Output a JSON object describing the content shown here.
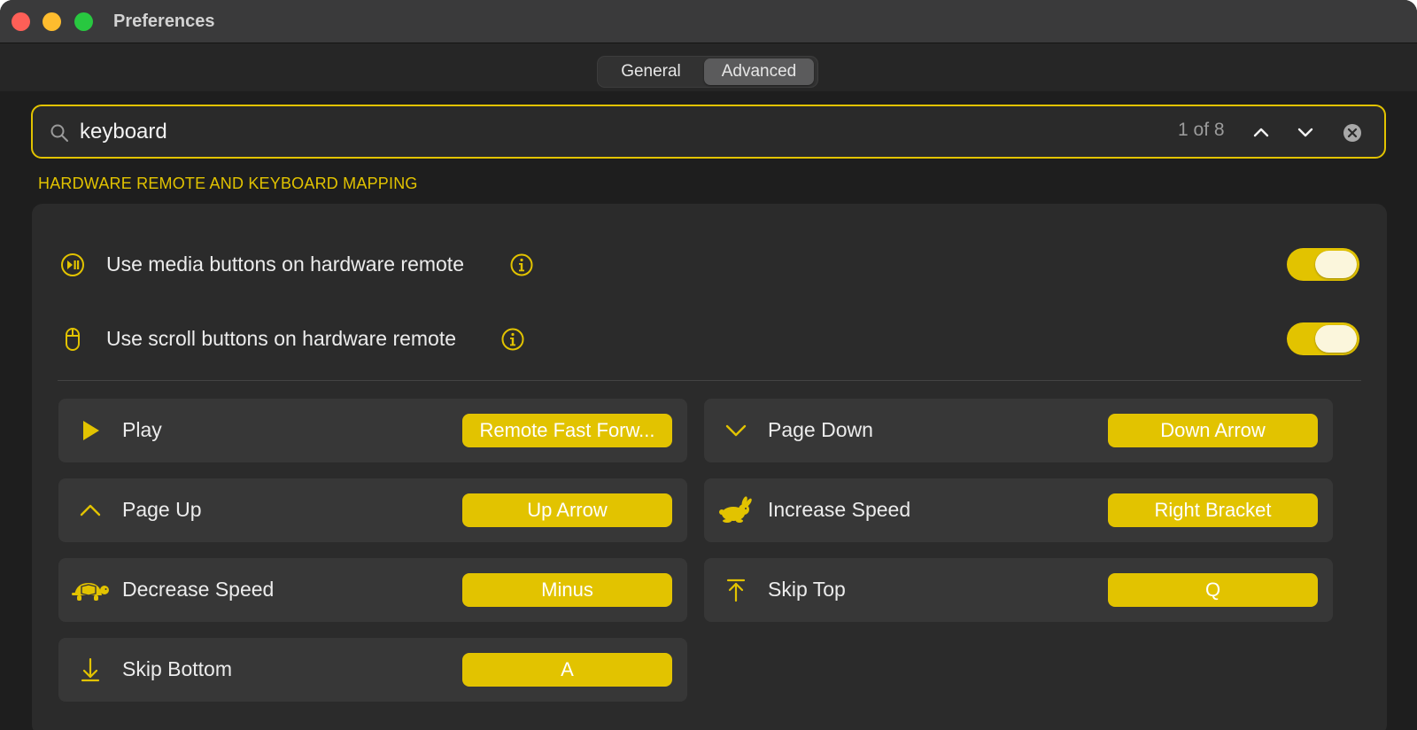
{
  "window": {
    "title": "Preferences"
  },
  "tabs": [
    {
      "label": "General",
      "selected": false
    },
    {
      "label": "Advanced",
      "selected": true
    }
  ],
  "search": {
    "value": "keyboard",
    "match_count": "1 of 8"
  },
  "section": {
    "title": "HARDWARE REMOTE AND KEYBOARD MAPPING"
  },
  "toggles": [
    {
      "label": "Use media buttons on hardware remote",
      "icon": "play-pause-icon",
      "on": true
    },
    {
      "label": "Use scroll buttons on hardware remote",
      "icon": "mouse-icon",
      "on": true
    }
  ],
  "mappings": [
    {
      "action": "Play",
      "icon": "play-icon",
      "key": "Remote Fast Forw..."
    },
    {
      "action": "Page Down",
      "icon": "chevron-down-icon",
      "key": "Down Arrow"
    },
    {
      "action": "Page Up",
      "icon": "chevron-up-icon",
      "key": "Up Arrow"
    },
    {
      "action": "Increase Speed",
      "icon": "rabbit-icon",
      "key": "Right Bracket"
    },
    {
      "action": "Decrease Speed",
      "icon": "turtle-icon",
      "key": "Minus"
    },
    {
      "action": "Skip Top",
      "icon": "arrow-up-to-line-icon",
      "key": "Q"
    },
    {
      "action": "Skip Bottom",
      "icon": "arrow-down-icon",
      "key": "A"
    }
  ],
  "colors": {
    "accent": "#e2c300",
    "window_background": "#1e1e1e",
    "panel_background": "#2b2b2b",
    "card_background": "#373737"
  }
}
